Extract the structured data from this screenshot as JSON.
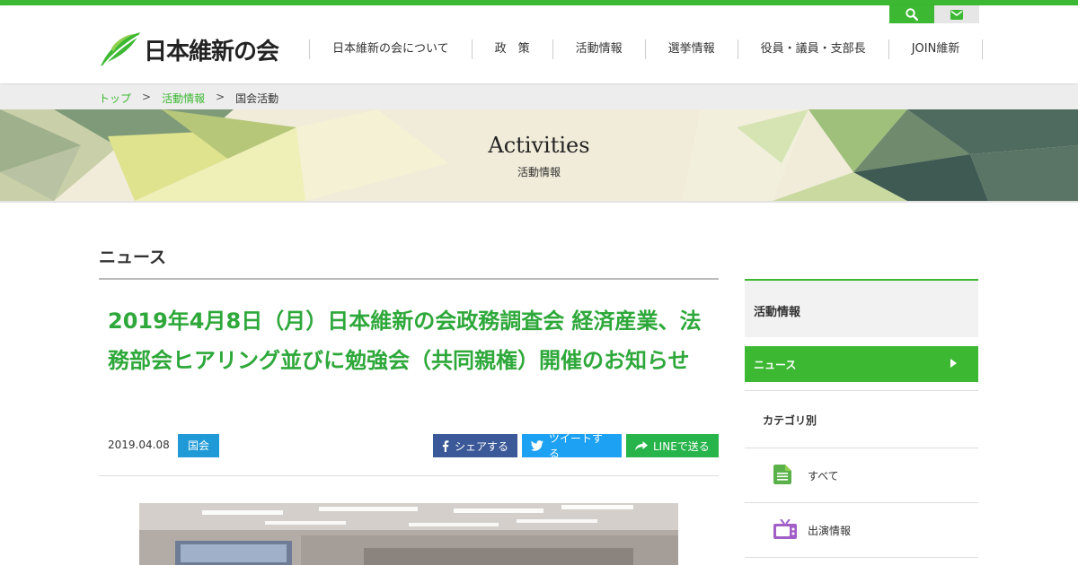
{
  "brand": {
    "name": "日本維新の会",
    "accent": "#3cb832",
    "title_green": "#2ea83a"
  },
  "utility": {
    "search_icon": "search-icon",
    "mail_icon": "mail-icon"
  },
  "nav": {
    "items": [
      {
        "label": "日本維新の会について"
      },
      {
        "label": "政　策"
      },
      {
        "label": "活動情報"
      },
      {
        "label": "選挙情報"
      },
      {
        "label": "役員・議員・支部長"
      },
      {
        "label": "JOIN維新"
      }
    ]
  },
  "breadcrumb": {
    "home": "トップ",
    "sep": ">",
    "section": "活動情報",
    "current": "国会活動"
  },
  "banner": {
    "title": "Activities",
    "subtitle": "活動情報"
  },
  "main": {
    "section_heading": "ニュース",
    "article": {
      "title": "2019年4月8日（月）日本維新の会政務調査会 経済産業、法務部会ヒアリング並びに勉強会（共同親権）開催のお知らせ",
      "date": "2019.04.08",
      "tag": "国会",
      "tag_color": "#1f9ad6"
    },
    "share": {
      "facebook": "シェアする",
      "twitter": "ツイートする",
      "line": "LINEで送る",
      "facebook_color": "#3b5998",
      "twitter_color": "#1da1f2",
      "line_color": "#27b44b"
    }
  },
  "sidebar": {
    "heading": "活動情報",
    "active_item": "ニュース",
    "category_heading": "カテゴリ別",
    "items": [
      {
        "label": "すべて",
        "icon": "document-icon"
      },
      {
        "label": "出演情報",
        "icon": "tv-icon"
      }
    ]
  }
}
